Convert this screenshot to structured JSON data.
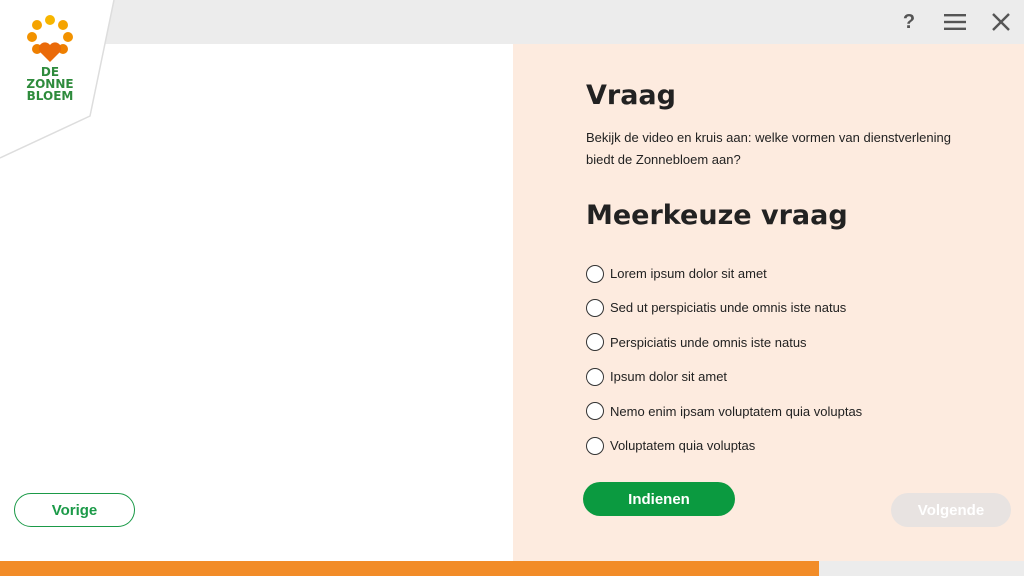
{
  "logo": {
    "text": "DE\nZONNE\nBLOEM"
  },
  "toolbar": {
    "help_label": "?",
    "icons": [
      "help-icon",
      "menu-icon",
      "close-icon"
    ]
  },
  "question": {
    "heading": "Vraag",
    "text": "Bekijk de video en kruis aan: welke vormen van dienstverlening biedt de Zonnebloem aan?"
  },
  "multiple_choice": {
    "heading": "Meerkeuze vraag",
    "options": [
      "Lorem ipsum dolor sit amet",
      "Sed ut perspiciatis unde omnis iste natus",
      "Perspiciatis unde omnis iste natus",
      "Ipsum dolor sit amet",
      "Nemo enim ipsam voluptatem quia voluptas",
      "Voluptatem quia voluptas"
    ]
  },
  "buttons": {
    "prev": "Vorige",
    "submit": "Indienen",
    "next": "Volgende"
  },
  "progress": {
    "fraction": 0.8
  },
  "colors": {
    "brand_green": "#1b9a48",
    "brand_orange": "#f28c28",
    "panel_bg": "#fdebdf",
    "disabled": "#e8e3e1"
  }
}
